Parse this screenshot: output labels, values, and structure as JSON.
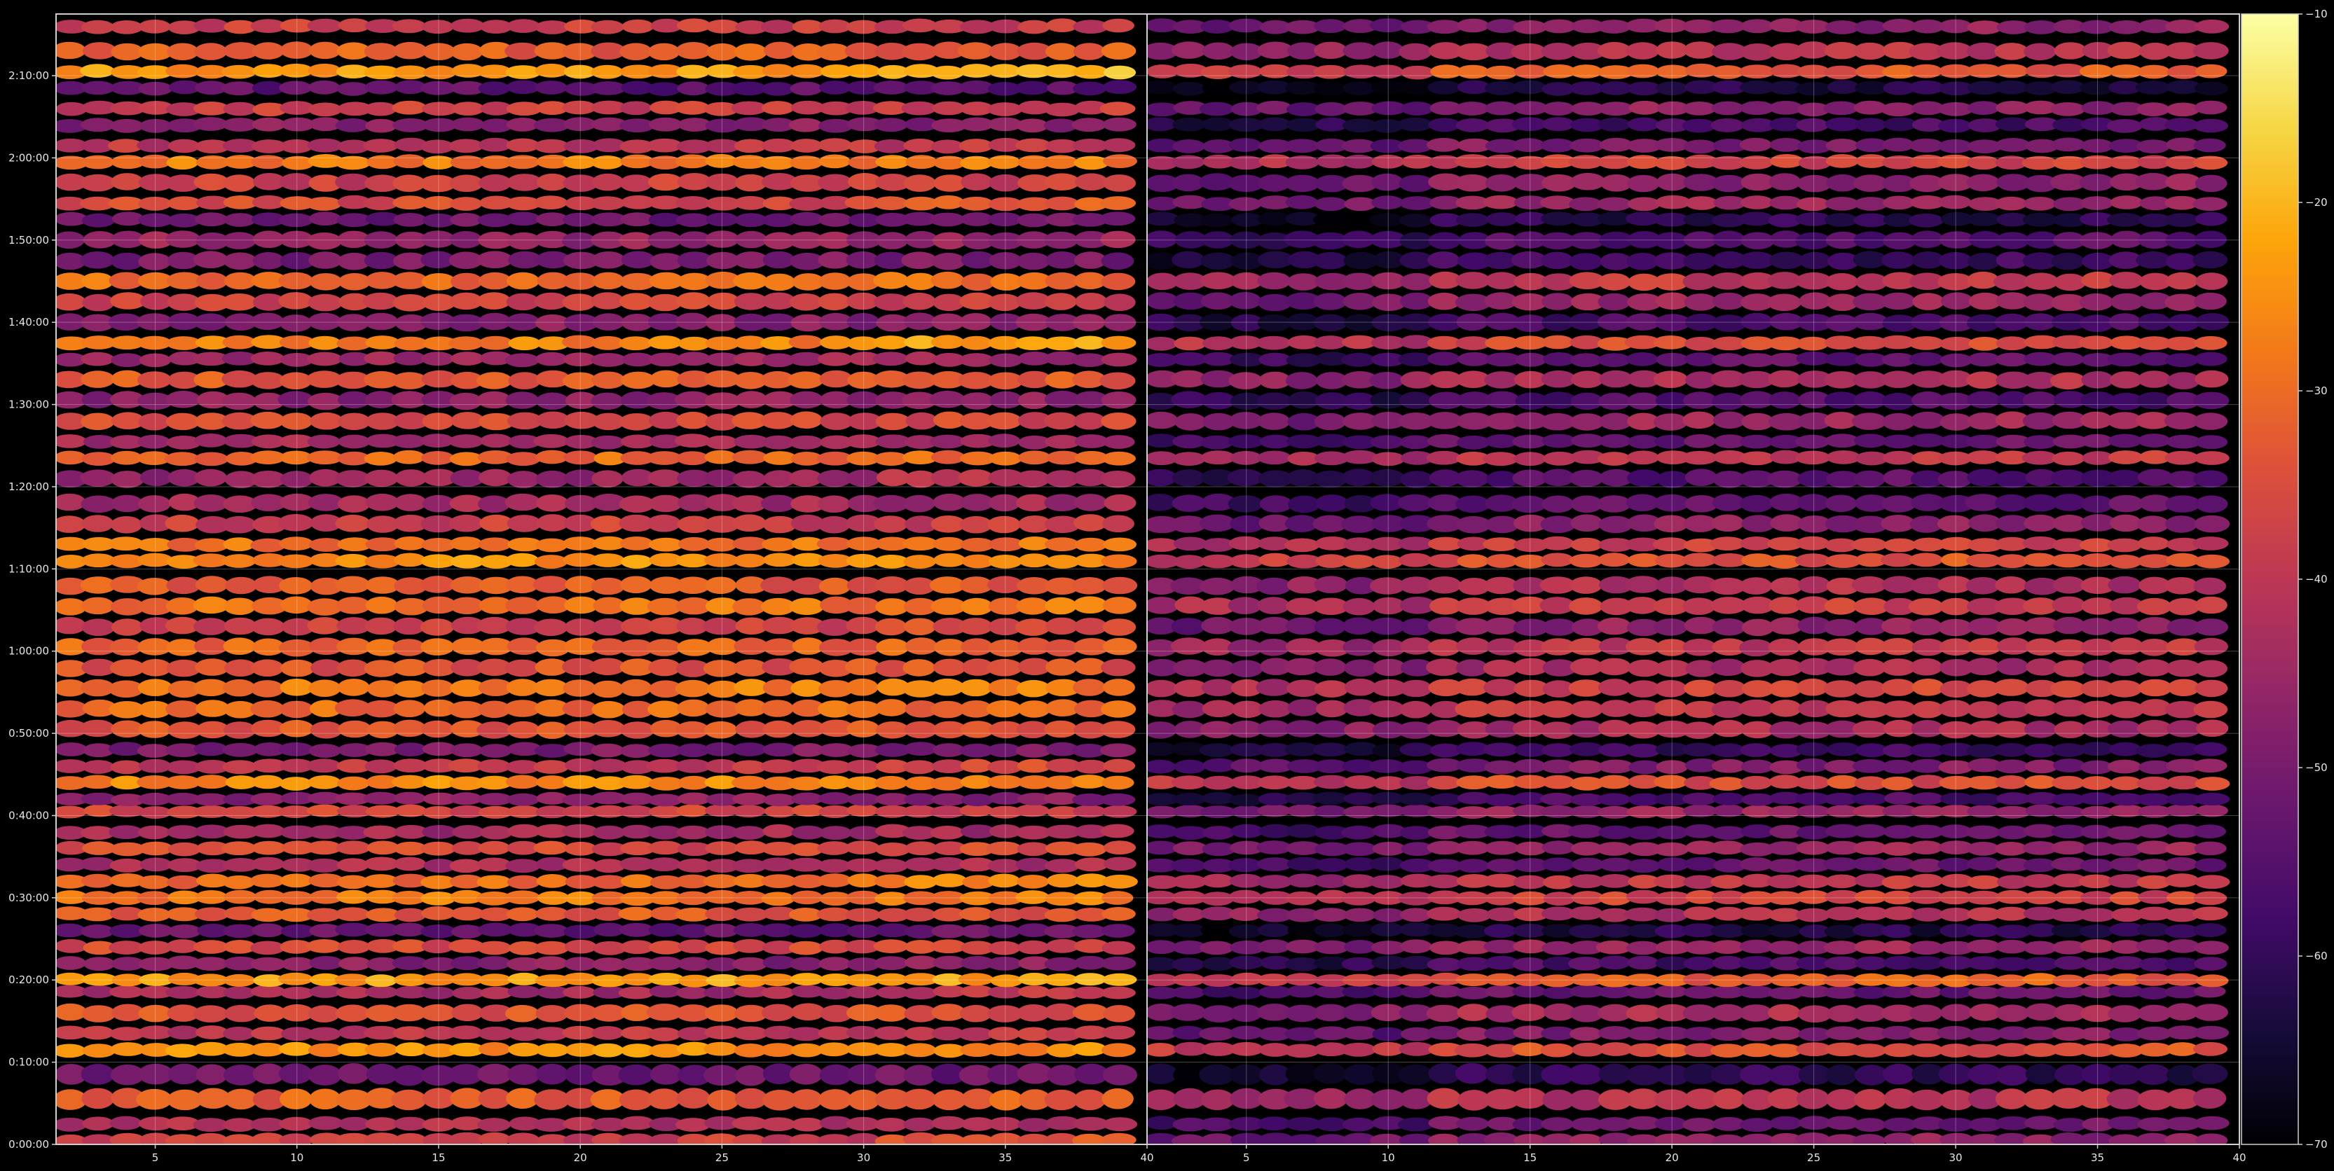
{
  "chart_data": {
    "type": "heatmap",
    "title": "",
    "xlabel": "",
    "ylabel": "",
    "grid": true,
    "colormap": "inferno",
    "background": "#000000",
    "axis_color": "#cfcfcf",
    "panels": [
      {
        "name": "",
        "xlim": [
          1.5,
          40
        ],
        "xticks": [
          5,
          10,
          15,
          20,
          25,
          30,
          35,
          40
        ]
      },
      {
        "name": "",
        "xlim": [
          1.5,
          40
        ],
        "xticks": [
          5,
          10,
          15,
          20,
          25,
          30,
          35,
          40
        ]
      }
    ],
    "y_axis": {
      "unit": "time",
      "ylim_seconds": [
        0,
        8250
      ],
      "ticks": [
        {
          "label": "0:00:00",
          "seconds": 0
        },
        {
          "label": "0:10:00",
          "seconds": 600
        },
        {
          "label": "0:20:00",
          "seconds": 1200
        },
        {
          "label": "0:30:00",
          "seconds": 1800
        },
        {
          "label": "0:40:00",
          "seconds": 2400
        },
        {
          "label": "0:50:00",
          "seconds": 3000
        },
        {
          "label": "1:00:00",
          "seconds": 3600
        },
        {
          "label": "1:10:00",
          "seconds": 4200
        },
        {
          "label": "1:20:00",
          "seconds": 4800
        },
        {
          "label": "1:30:00",
          "seconds": 5400
        },
        {
          "label": "1:40:00",
          "seconds": 6000
        },
        {
          "label": "1:50:00",
          "seconds": 6600
        },
        {
          "label": "2:00:00",
          "seconds": 7200
        },
        {
          "label": "2:10:00",
          "seconds": 7800
        }
      ]
    },
    "colorbar": {
      "range": [
        -70,
        -10
      ],
      "ticks": [
        -10,
        -20,
        -30,
        -40,
        -50,
        -60,
        -70
      ]
    },
    "bands": [
      {
        "t": 30,
        "level": -38
      },
      {
        "t": 150,
        "level": -42
      },
      {
        "t": 330,
        "level": -32
      },
      {
        "t": 510,
        "level": -52
      },
      {
        "t": 690,
        "level": -25
      },
      {
        "t": 810,
        "level": -40
      },
      {
        "t": 960,
        "level": -34
      },
      {
        "t": 1110,
        "level": -44
      },
      {
        "t": 1200,
        "level": -23
      },
      {
        "t": 1320,
        "level": -48
      },
      {
        "t": 1440,
        "level": -36
      },
      {
        "t": 1560,
        "level": -53
      },
      {
        "t": 1680,
        "level": -33
      },
      {
        "t": 1800,
        "level": -28
      },
      {
        "t": 1920,
        "level": -30
      },
      {
        "t": 2040,
        "level": -43
      },
      {
        "t": 2160,
        "level": -36
      },
      {
        "t": 2280,
        "level": -44
      },
      {
        "t": 2430,
        "level": -37
      },
      {
        "t": 2520,
        "level": -48
      },
      {
        "t": 2640,
        "level": -26
      },
      {
        "t": 2760,
        "level": -40
      },
      {
        "t": 2880,
        "level": -50
      },
      {
        "t": 3030,
        "level": -34
      },
      {
        "t": 3180,
        "level": -30
      },
      {
        "t": 3330,
        "level": -28
      },
      {
        "t": 3480,
        "level": -34
      },
      {
        "t": 3630,
        "level": -31
      },
      {
        "t": 3780,
        "level": -38
      },
      {
        "t": 3930,
        "level": -29
      },
      {
        "t": 4080,
        "level": -33
      },
      {
        "t": 4260,
        "level": -25
      },
      {
        "t": 4380,
        "level": -29
      },
      {
        "t": 4530,
        "level": -38
      },
      {
        "t": 4680,
        "level": -44
      },
      {
        "t": 4860,
        "level": -46
      },
      {
        "t": 5010,
        "level": -30
      },
      {
        "t": 5130,
        "level": -44
      },
      {
        "t": 5280,
        "level": -36
      },
      {
        "t": 5430,
        "level": -47
      },
      {
        "t": 5580,
        "level": -33
      },
      {
        "t": 5730,
        "level": -45
      },
      {
        "t": 5850,
        "level": -27
      },
      {
        "t": 6000,
        "level": -48
      },
      {
        "t": 6150,
        "level": -37
      },
      {
        "t": 6300,
        "level": -30
      },
      {
        "t": 6450,
        "level": -50
      },
      {
        "t": 6600,
        "level": -46
      },
      {
        "t": 6750,
        "level": -52
      },
      {
        "t": 6870,
        "level": -36
      },
      {
        "t": 7020,
        "level": -38
      },
      {
        "t": 7170,
        "level": -28
      },
      {
        "t": 7290,
        "level": -40
      },
      {
        "t": 7440,
        "level": -48
      },
      {
        "t": 7560,
        "level": -38
      },
      {
        "t": 7710,
        "level": -54
      },
      {
        "t": 7830,
        "level": -24
      },
      {
        "t": 7980,
        "level": -32
      },
      {
        "t": 8160,
        "level": -38
      }
    ]
  }
}
